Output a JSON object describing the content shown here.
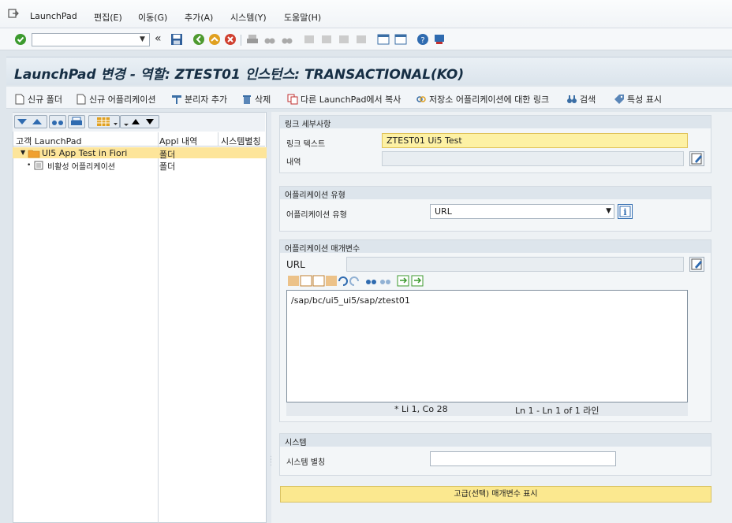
{
  "menu": [
    "LaunchPad",
    "편집(E)",
    "이동(G)",
    "추가(A)",
    "시스템(Y)",
    "도움말(H)"
  ],
  "title": "LaunchPad 변경 - 역할: ZTEST01 인스턴스: TRANSACTIONAL(KO)",
  "app_toolbar": {
    "new_folder": "신규 폴더",
    "new_app": "신규 어플리케이션",
    "add_separator": "분리자 추가",
    "delete": "삭제",
    "copy_other": "다른 LaunchPad에서 복사",
    "repo_link": "저장소 어플리케이션에 대한 링크",
    "search": "검색",
    "show_props": "특성 표시"
  },
  "tree": {
    "col_customer": "고객 LaunchPad",
    "col_appl": "Appl 내역",
    "col_alias": "시스템별칭",
    "rows": [
      {
        "name": "UI5 App Test in Fiori",
        "appl": "폴더"
      },
      {
        "name": "비활성 어플리케이션",
        "appl": "폴더"
      }
    ]
  },
  "link_details": {
    "header": "링크 세부사항",
    "text_label": "링크 텍스트",
    "text_value": "ZTEST01 Ui5 Test",
    "desc_label": "내역",
    "desc_value": ""
  },
  "app_type": {
    "header": "어플리케이션 유형",
    "label": "어플리케이션 유형",
    "value": "URL"
  },
  "app_params": {
    "header": "어플리케이션 매개변수",
    "url_label": "URL",
    "url_value": "",
    "editor_text": "/sap/bc/ui5_ui5/sap/ztest01",
    "status_pos": "* Li 1, Co 28",
    "status_lines": "Ln 1 - Ln 1 of 1 라인"
  },
  "system": {
    "header": "시스템",
    "alias_label": "시스템 별칭",
    "alias_value": ""
  },
  "advanced_button": "고급(선택) 매개변수 표시",
  "colors": {
    "accent_yellow": "#fde59a",
    "title_bg": "#dbe4ec"
  }
}
